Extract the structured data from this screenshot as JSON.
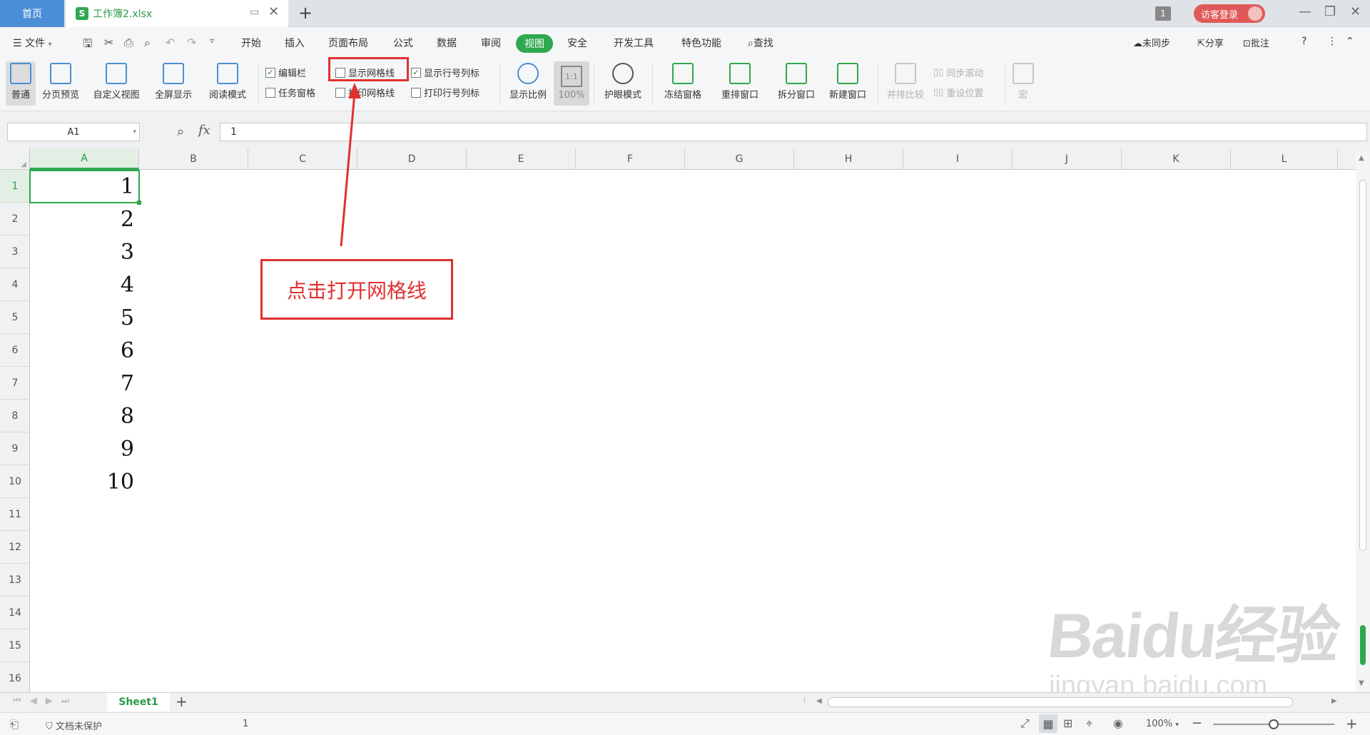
{
  "titlebar": {
    "home_tab": "首页",
    "doc_tab": "工作簿2.xlsx",
    "doc_logo": "S",
    "new_tab": "+",
    "window_badge": "1",
    "login_button": "访客登录"
  },
  "menubar": {
    "file_menu": "文件",
    "tabs": [
      "开始",
      "插入",
      "页面布局",
      "公式",
      "数据",
      "审阅",
      "视图",
      "安全",
      "开发工具",
      "特色功能"
    ],
    "active_tab": "视图",
    "search": "查找",
    "sync": "未同步",
    "share": "分享",
    "comment": "批注"
  },
  "ribbon": {
    "normal": "普通",
    "page_break_preview": "分页预览",
    "custom_view": "自定义视图",
    "full_screen": "全屏显示",
    "reading_mode": "阅读模式",
    "edit_bar": "编辑栏",
    "task_pane": "任务窗格",
    "show_gridlines": "显示网格线",
    "print_gridlines": "打印网格线",
    "show_row_col_headers": "显示行号列标",
    "print_row_col_headers": "打印行号列标",
    "zoom": "显示比例",
    "zoom_100": "100%",
    "zoom_icon_label": "1:1",
    "eye_protection": "护眼模式",
    "freeze_panes": "冻结窗格",
    "arrange_windows": "重排窗口",
    "split_window": "拆分窗口",
    "new_window": "新建窗口",
    "side_by_side": "并排比较",
    "sync_scroll": "同步滚动",
    "reset_position": "重设位置",
    "macro": "宏",
    "checks": {
      "edit_bar": true,
      "task_pane": false,
      "show_gridlines": false,
      "print_gridlines": false,
      "show_row_col_headers": true,
      "print_row_col_headers": false
    }
  },
  "formula_bar": {
    "name_box": "A1",
    "fx": "fx",
    "value": "1"
  },
  "grid": {
    "columns": [
      "A",
      "B",
      "C",
      "D",
      "E",
      "F",
      "G",
      "H",
      "I",
      "J",
      "K",
      "L"
    ],
    "rows": [
      "1",
      "2",
      "3",
      "4",
      "5",
      "6",
      "7",
      "8",
      "9",
      "10",
      "11",
      "12",
      "13",
      "14",
      "15",
      "16"
    ],
    "column_a_values": [
      "1",
      "2",
      "3",
      "4",
      "5",
      "6",
      "7",
      "8",
      "9",
      "10"
    ]
  },
  "sheets": {
    "active": "Sheet1",
    "add": "+"
  },
  "statusbar": {
    "protection": "文档未保护",
    "cell_value": "1",
    "zoom": "100%"
  },
  "annotation": {
    "text": "点击打开网格线"
  },
  "watermark": {
    "logo_text": "Baidu经验",
    "url": "jingyan.baidu.com"
  },
  "colors": {
    "accent_green": "#2fa84f",
    "annotation_red": "#e03030",
    "home_tab_blue": "#4a8fd6"
  }
}
